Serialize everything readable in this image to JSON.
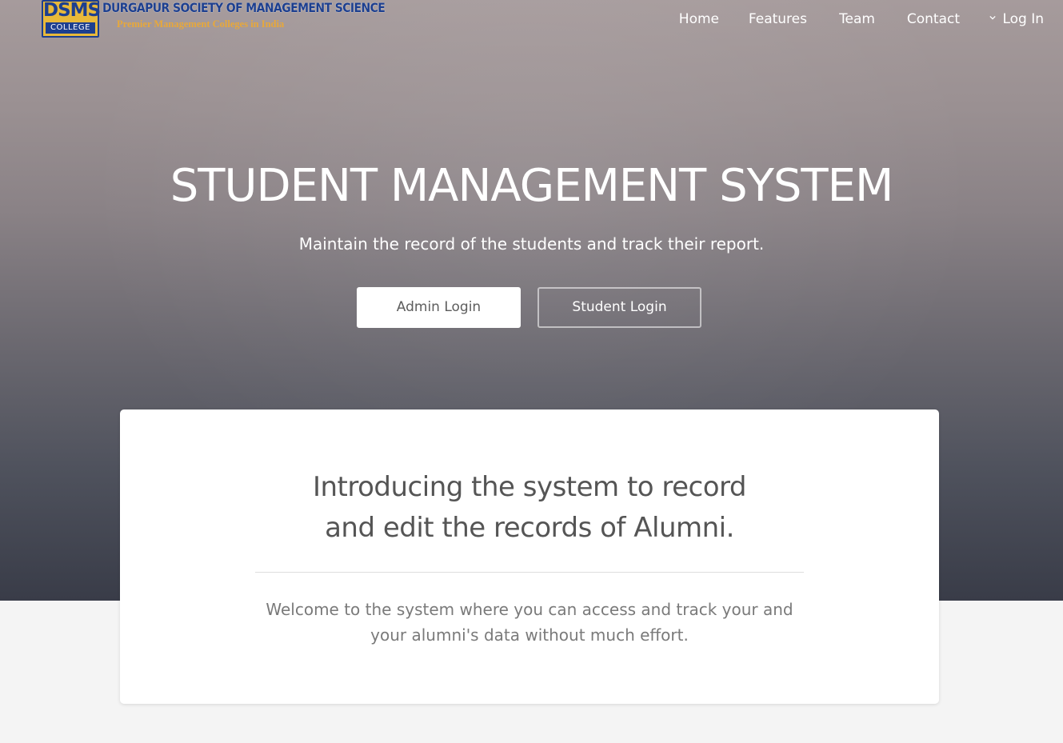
{
  "logo": {
    "abbr": "DSMS",
    "badge_label": "COLLEGE",
    "name": "DURGAPUR SOCIETY OF MANAGEMENT SCIENCE",
    "tagline": "Premier Management Colleges in India"
  },
  "nav": {
    "items": [
      {
        "label": "Home"
      },
      {
        "label": "Features"
      },
      {
        "label": "Team"
      },
      {
        "label": "Contact"
      }
    ],
    "login_label": "Log In"
  },
  "hero": {
    "title": "STUDENT MANAGEMENT SYSTEM",
    "subtitle": "Maintain the record of the students and track their report.",
    "admin_button": "Admin Login",
    "student_button": "Student Login"
  },
  "card": {
    "heading_line1": "Introducing the system to record",
    "heading_line2": "and edit the records of Alumni.",
    "text_line1": "Welcome to the system where you can access and track your and",
    "text_line2": "your alumni's data without much effort."
  },
  "colors": {
    "brand_blue": "#1d3f8f",
    "brand_gold": "#e8b93a",
    "page_bg": "#f4f4f4"
  }
}
